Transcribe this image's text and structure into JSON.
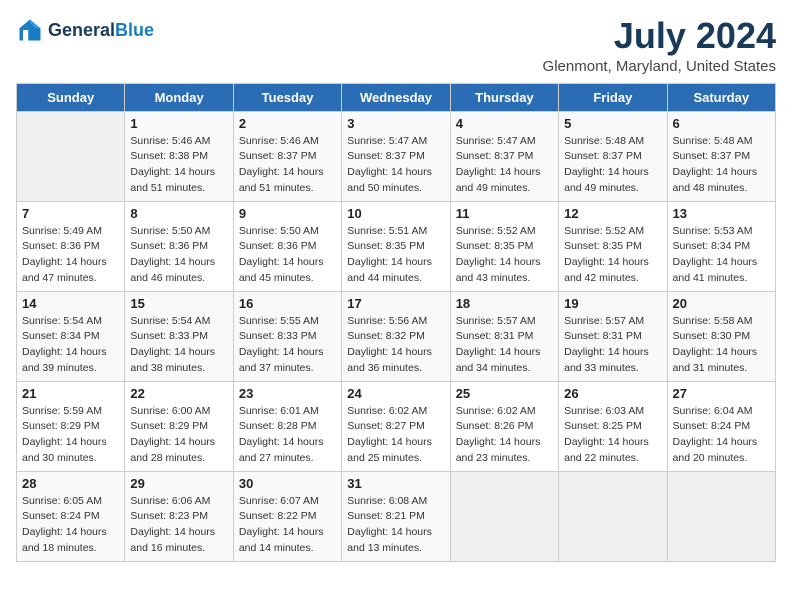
{
  "logo": {
    "text_general": "General",
    "text_blue": "Blue"
  },
  "header": {
    "title": "July 2024",
    "subtitle": "Glenmont, Maryland, United States"
  },
  "weekdays": [
    "Sunday",
    "Monday",
    "Tuesday",
    "Wednesday",
    "Thursday",
    "Friday",
    "Saturday"
  ],
  "weeks": [
    [
      {
        "day": "",
        "sunrise": "",
        "sunset": "",
        "daylight": ""
      },
      {
        "day": "1",
        "sunrise": "Sunrise: 5:46 AM",
        "sunset": "Sunset: 8:38 PM",
        "daylight": "Daylight: 14 hours and 51 minutes."
      },
      {
        "day": "2",
        "sunrise": "Sunrise: 5:46 AM",
        "sunset": "Sunset: 8:37 PM",
        "daylight": "Daylight: 14 hours and 51 minutes."
      },
      {
        "day": "3",
        "sunrise": "Sunrise: 5:47 AM",
        "sunset": "Sunset: 8:37 PM",
        "daylight": "Daylight: 14 hours and 50 minutes."
      },
      {
        "day": "4",
        "sunrise": "Sunrise: 5:47 AM",
        "sunset": "Sunset: 8:37 PM",
        "daylight": "Daylight: 14 hours and 49 minutes."
      },
      {
        "day": "5",
        "sunrise": "Sunrise: 5:48 AM",
        "sunset": "Sunset: 8:37 PM",
        "daylight": "Daylight: 14 hours and 49 minutes."
      },
      {
        "day": "6",
        "sunrise": "Sunrise: 5:48 AM",
        "sunset": "Sunset: 8:37 PM",
        "daylight": "Daylight: 14 hours and 48 minutes."
      }
    ],
    [
      {
        "day": "7",
        "sunrise": "Sunrise: 5:49 AM",
        "sunset": "Sunset: 8:36 PM",
        "daylight": "Daylight: 14 hours and 47 minutes."
      },
      {
        "day": "8",
        "sunrise": "Sunrise: 5:50 AM",
        "sunset": "Sunset: 8:36 PM",
        "daylight": "Daylight: 14 hours and 46 minutes."
      },
      {
        "day": "9",
        "sunrise": "Sunrise: 5:50 AM",
        "sunset": "Sunset: 8:36 PM",
        "daylight": "Daylight: 14 hours and 45 minutes."
      },
      {
        "day": "10",
        "sunrise": "Sunrise: 5:51 AM",
        "sunset": "Sunset: 8:35 PM",
        "daylight": "Daylight: 14 hours and 44 minutes."
      },
      {
        "day": "11",
        "sunrise": "Sunrise: 5:52 AM",
        "sunset": "Sunset: 8:35 PM",
        "daylight": "Daylight: 14 hours and 43 minutes."
      },
      {
        "day": "12",
        "sunrise": "Sunrise: 5:52 AM",
        "sunset": "Sunset: 8:35 PM",
        "daylight": "Daylight: 14 hours and 42 minutes."
      },
      {
        "day": "13",
        "sunrise": "Sunrise: 5:53 AM",
        "sunset": "Sunset: 8:34 PM",
        "daylight": "Daylight: 14 hours and 41 minutes."
      }
    ],
    [
      {
        "day": "14",
        "sunrise": "Sunrise: 5:54 AM",
        "sunset": "Sunset: 8:34 PM",
        "daylight": "Daylight: 14 hours and 39 minutes."
      },
      {
        "day": "15",
        "sunrise": "Sunrise: 5:54 AM",
        "sunset": "Sunset: 8:33 PM",
        "daylight": "Daylight: 14 hours and 38 minutes."
      },
      {
        "day": "16",
        "sunrise": "Sunrise: 5:55 AM",
        "sunset": "Sunset: 8:33 PM",
        "daylight": "Daylight: 14 hours and 37 minutes."
      },
      {
        "day": "17",
        "sunrise": "Sunrise: 5:56 AM",
        "sunset": "Sunset: 8:32 PM",
        "daylight": "Daylight: 14 hours and 36 minutes."
      },
      {
        "day": "18",
        "sunrise": "Sunrise: 5:57 AM",
        "sunset": "Sunset: 8:31 PM",
        "daylight": "Daylight: 14 hours and 34 minutes."
      },
      {
        "day": "19",
        "sunrise": "Sunrise: 5:57 AM",
        "sunset": "Sunset: 8:31 PM",
        "daylight": "Daylight: 14 hours and 33 minutes."
      },
      {
        "day": "20",
        "sunrise": "Sunrise: 5:58 AM",
        "sunset": "Sunset: 8:30 PM",
        "daylight": "Daylight: 14 hours and 31 minutes."
      }
    ],
    [
      {
        "day": "21",
        "sunrise": "Sunrise: 5:59 AM",
        "sunset": "Sunset: 8:29 PM",
        "daylight": "Daylight: 14 hours and 30 minutes."
      },
      {
        "day": "22",
        "sunrise": "Sunrise: 6:00 AM",
        "sunset": "Sunset: 8:29 PM",
        "daylight": "Daylight: 14 hours and 28 minutes."
      },
      {
        "day": "23",
        "sunrise": "Sunrise: 6:01 AM",
        "sunset": "Sunset: 8:28 PM",
        "daylight": "Daylight: 14 hours and 27 minutes."
      },
      {
        "day": "24",
        "sunrise": "Sunrise: 6:02 AM",
        "sunset": "Sunset: 8:27 PM",
        "daylight": "Daylight: 14 hours and 25 minutes."
      },
      {
        "day": "25",
        "sunrise": "Sunrise: 6:02 AM",
        "sunset": "Sunset: 8:26 PM",
        "daylight": "Daylight: 14 hours and 23 minutes."
      },
      {
        "day": "26",
        "sunrise": "Sunrise: 6:03 AM",
        "sunset": "Sunset: 8:25 PM",
        "daylight": "Daylight: 14 hours and 22 minutes."
      },
      {
        "day": "27",
        "sunrise": "Sunrise: 6:04 AM",
        "sunset": "Sunset: 8:24 PM",
        "daylight": "Daylight: 14 hours and 20 minutes."
      }
    ],
    [
      {
        "day": "28",
        "sunrise": "Sunrise: 6:05 AM",
        "sunset": "Sunset: 8:24 PM",
        "daylight": "Daylight: 14 hours and 18 minutes."
      },
      {
        "day": "29",
        "sunrise": "Sunrise: 6:06 AM",
        "sunset": "Sunset: 8:23 PM",
        "daylight": "Daylight: 14 hours and 16 minutes."
      },
      {
        "day": "30",
        "sunrise": "Sunrise: 6:07 AM",
        "sunset": "Sunset: 8:22 PM",
        "daylight": "Daylight: 14 hours and 14 minutes."
      },
      {
        "day": "31",
        "sunrise": "Sunrise: 6:08 AM",
        "sunset": "Sunset: 8:21 PM",
        "daylight": "Daylight: 14 hours and 13 minutes."
      },
      {
        "day": "",
        "sunrise": "",
        "sunset": "",
        "daylight": ""
      },
      {
        "day": "",
        "sunrise": "",
        "sunset": "",
        "daylight": ""
      },
      {
        "day": "",
        "sunrise": "",
        "sunset": "",
        "daylight": ""
      }
    ]
  ]
}
